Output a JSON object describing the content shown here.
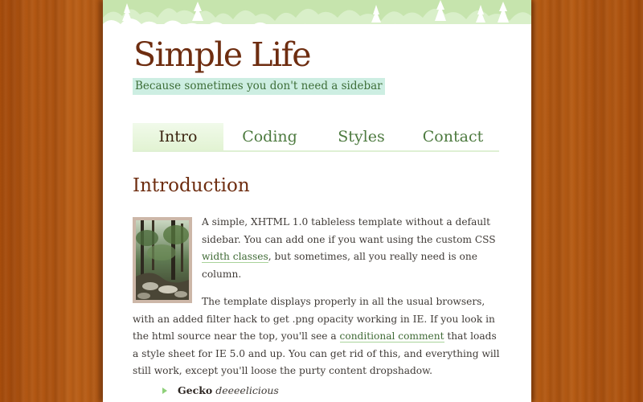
{
  "site": {
    "title": "Simple Life",
    "tagline": "Because sometimes you don't need a sidebar"
  },
  "nav": {
    "items": [
      {
        "label": "Intro",
        "active": true
      },
      {
        "label": "Coding",
        "active": false
      },
      {
        "label": "Styles",
        "active": false
      },
      {
        "label": "Contact",
        "active": false
      }
    ]
  },
  "main": {
    "heading": "Introduction",
    "paragraphs": [
      {
        "before": "A simple, XHTML 1.0 tableless template without a default sidebar. You can add one if you want using the custom CSS ",
        "link": "width classes",
        "after": ", but sometimes, all you really need is one column."
      },
      {
        "before": "The template displays properly in all the usual browsers, with an added filter hack to get .png opacity working in IE. If you look in the html source near the top, you'll see a ",
        "link": "conditional comment",
        "after": " that loads a style sheet for IE 5.0 and up. You can get rid of this, and everything will still work, except you'll loose the purty content dropshadow."
      }
    ],
    "list": [
      {
        "bold": "Gecko",
        "italic": "deeeelicious"
      }
    ]
  },
  "colors": {
    "wood": "#b5580f",
    "title": "#6e2d10",
    "tagline_bg": "#cdeee2",
    "nav_text": "#4d7a3f",
    "link": "#3f6a35"
  }
}
